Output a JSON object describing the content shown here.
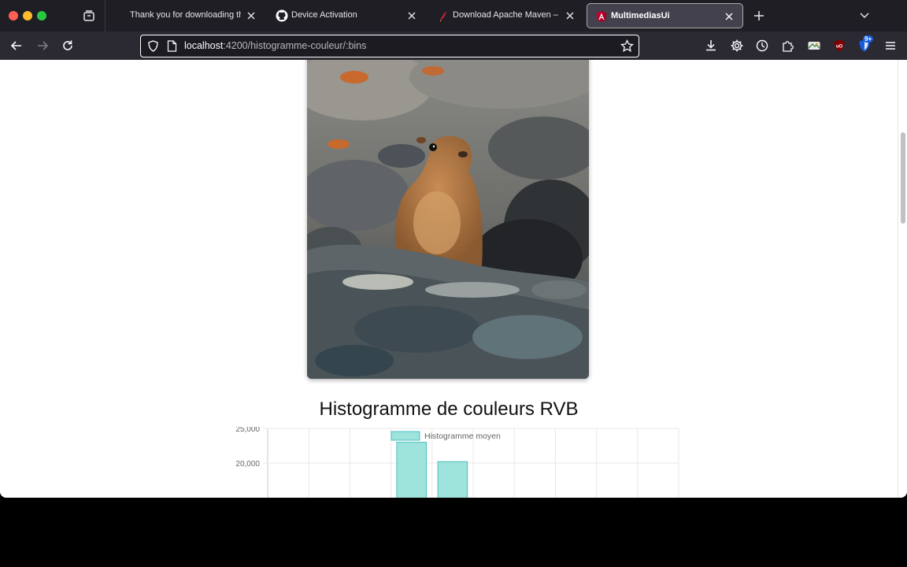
{
  "browser": {
    "tabs": [
      {
        "title": "Thank you for downloading the",
        "icon": "none",
        "active": false
      },
      {
        "title": "Device Activation",
        "icon": "github-icon",
        "active": false
      },
      {
        "title": "Download Apache Maven – Mav",
        "icon": "maven-feather-icon",
        "active": false
      },
      {
        "title": "MultimediasUi",
        "icon": "angular-icon",
        "active": true
      }
    ],
    "url": {
      "host": "localhost",
      "path": ":4200/histogramme-couleur/:bins"
    },
    "extension_badge": "9+",
    "colors": {
      "tabstrip": "#1f1e25",
      "toolbar": "#2b2a33",
      "urlbar": "#1c1b22"
    }
  },
  "page": {
    "title": "Histogramme de couleurs RVB"
  },
  "chart_data": {
    "type": "bar",
    "legend": [
      "Histogramme moyen"
    ],
    "legend_position": "top",
    "yticks": [
      "25,000",
      "20,000"
    ],
    "ylim_visible": [
      20000,
      25000
    ],
    "grid": true,
    "bar_color": "#9ee3dc",
    "bar_border": "#4bc0c0",
    "series": [
      {
        "name": "Histogramme moyen",
        "values": [
          null,
          null,
          null,
          23000,
          20200,
          null,
          null,
          null,
          null,
          null
        ]
      }
    ]
  }
}
